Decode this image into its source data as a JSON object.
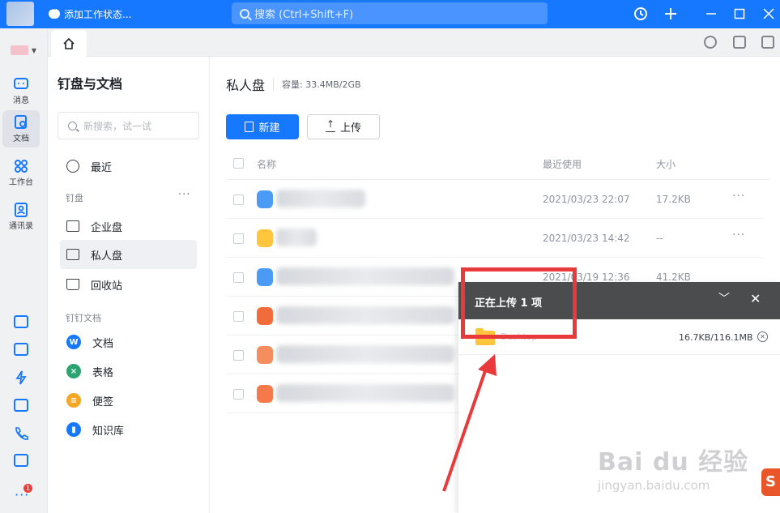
{
  "titlebar": {
    "status_text": "添加工作状态...",
    "search_placeholder": "搜索 (Ctrl+Shift+F)"
  },
  "rail": {
    "items": [
      {
        "label": "消息",
        "icon": "message-icon"
      },
      {
        "label": "文档",
        "icon": "document-icon",
        "active": true
      },
      {
        "label": "工作台",
        "icon": "workbench-icon"
      },
      {
        "label": "通讯录",
        "icon": "contacts-icon"
      }
    ],
    "more_badge": "1"
  },
  "docside": {
    "title": "钉盘与文档",
    "search_placeholder": "新搜索，试一试",
    "recent": "最近",
    "section_disk": "钉盘",
    "enterprise": "企业盘",
    "private": "私人盘",
    "trash": "回收站",
    "section_docs": "钉钉文档",
    "doc": "文档",
    "sheet": "表格",
    "note": "便签",
    "kb": "知识库"
  },
  "main": {
    "title": "私人盘",
    "capacity": "容量: 33.4MB/2GB",
    "new_button": "新建",
    "upload_button": "上传",
    "columns": {
      "name": "名称",
      "recent": "最近使用",
      "size": "大小"
    },
    "rows": [
      {
        "date": "2021/03/23 22:07",
        "size": "17.2KB"
      },
      {
        "date": "2021/03/23 14:42",
        "size": "--"
      },
      {
        "date": "2021/03/19 12:36",
        "size": "41.2KB"
      },
      {
        "date": "",
        "size": ""
      },
      {
        "date": "",
        "size": ""
      },
      {
        "date": "",
        "size": ""
      }
    ]
  },
  "upload": {
    "title": "正在上传 1 项",
    "file_name": "Desktop",
    "progress": "16.7KB/116.1MB"
  },
  "watermark": {
    "brand": "Bai du 经验",
    "url": "jingyan.baidu.com"
  },
  "colors": {
    "accent": "#1677ff",
    "annotation": "#e83a3a"
  }
}
